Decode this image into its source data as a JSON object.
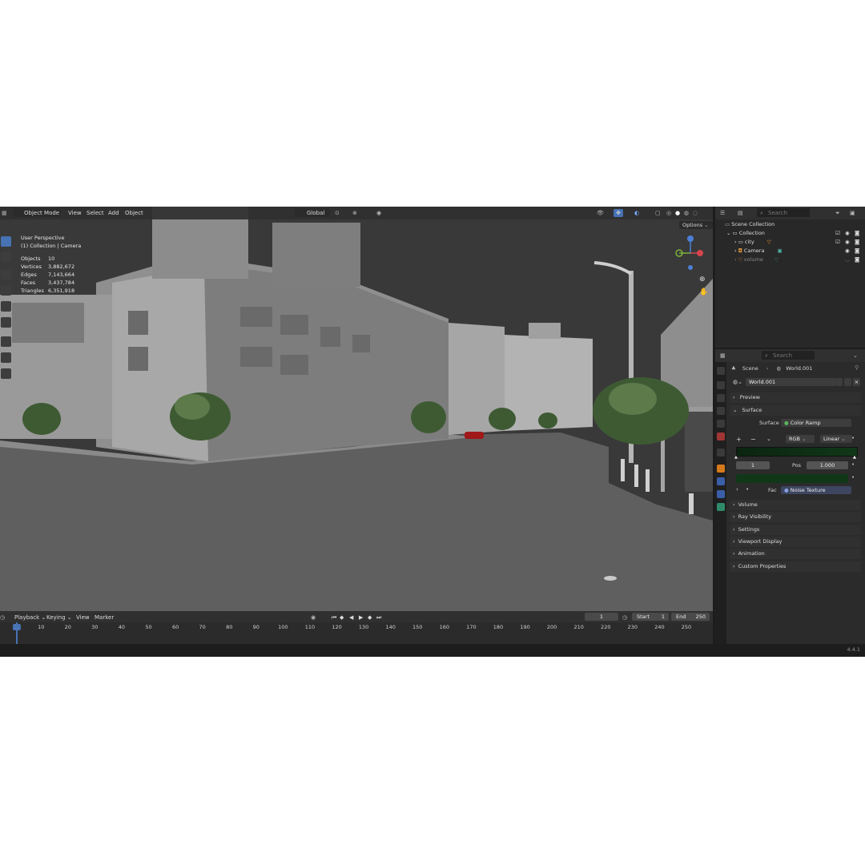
{
  "viewport": {
    "header": {
      "mode": "Object Mode",
      "menus": [
        "View",
        "Select",
        "Add",
        "Object"
      ],
      "transform_orientation": "Global",
      "options_label": "Options"
    },
    "overlay": {
      "perspective": "User Perspective",
      "context": "(1) Collection | Camera",
      "stats": [
        {
          "label": "Objects",
          "value": "10"
        },
        {
          "label": "Vertices",
          "value": "3,882,672"
        },
        {
          "label": "Edges",
          "value": "7,143,664"
        },
        {
          "label": "Faces",
          "value": "3,437,784"
        },
        {
          "label": "Triangles",
          "value": "6,351,918"
        }
      ]
    }
  },
  "outliner": {
    "search_placeholder": "Search",
    "items": [
      {
        "label": "Scene Collection"
      },
      {
        "label": "Collection"
      },
      {
        "label": "city"
      },
      {
        "label": "Camera"
      },
      {
        "label": "volume"
      }
    ]
  },
  "properties": {
    "search_placeholder": "Search",
    "breadcrumb": {
      "scene": "Scene",
      "world": "World.001"
    },
    "world_name": "World.001",
    "panels": {
      "preview": "Preview",
      "surface": "Surface",
      "surface_label": "Surface",
      "surface_value": "Color Ramp",
      "color_mode": "RGB",
      "interpolation": "Linear",
      "stop_index": "1",
      "pos_label": "Pos",
      "pos_value": "1.000",
      "fac_label": "Fac",
      "fac_value": "Noise Texture",
      "volume": "Volume",
      "ray_visibility": "Ray Visibility",
      "settings": "Settings",
      "viewport_display": "Viewport Display",
      "animation": "Animation",
      "custom_properties": "Custom Properties"
    }
  },
  "timeline": {
    "menus": [
      "Playback",
      "Keying",
      "View",
      "Marker"
    ],
    "current_frame": "1",
    "start_label": "Start",
    "start_value": "1",
    "end_label": "End",
    "end_value": "250",
    "ruler": [
      "1",
      "10",
      "20",
      "30",
      "40",
      "50",
      "60",
      "70",
      "80",
      "90",
      "100",
      "110",
      "120",
      "130",
      "140",
      "150",
      "160",
      "170",
      "180",
      "190",
      "200",
      "210",
      "220",
      "230",
      "240",
      "250"
    ]
  },
  "status": {
    "version": "4.4.1"
  },
  "colors": {
    "accent": "#4772b3",
    "ramp_dark": "#0e2a14",
    "ramp_field": "#103818"
  }
}
